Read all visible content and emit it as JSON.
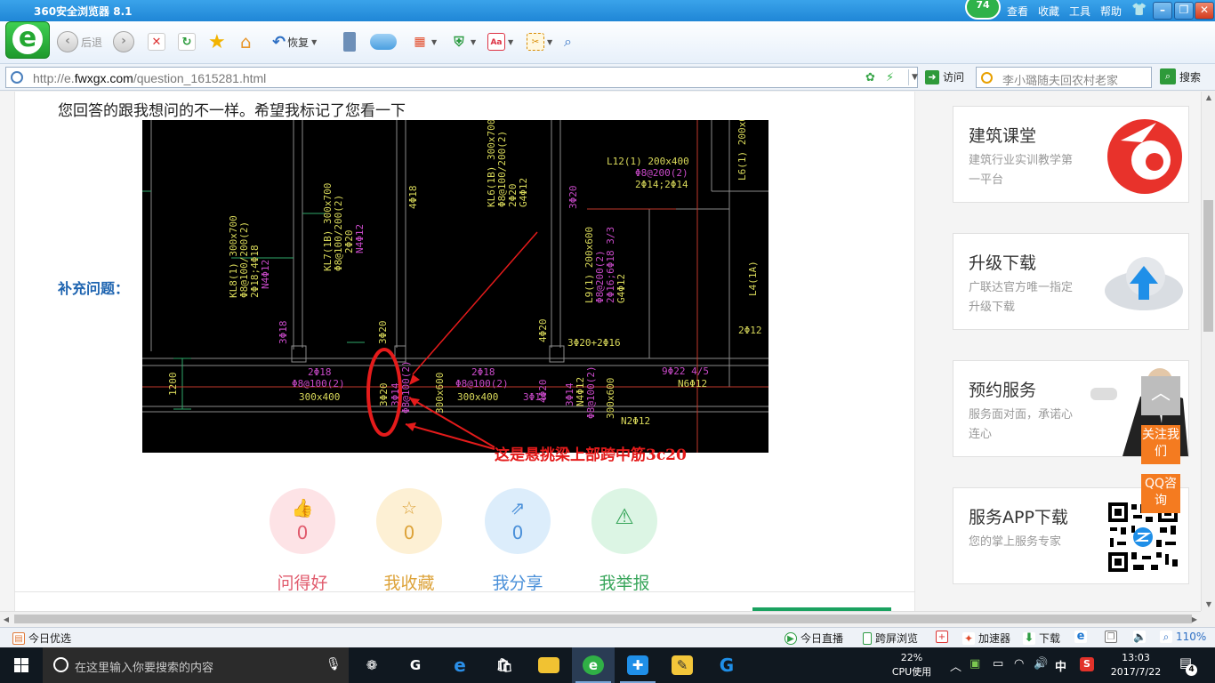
{
  "window": {
    "title": "360安全浏览器 8.1",
    "badge": "74",
    "menu": [
      "查看",
      "收藏",
      "工具",
      "帮助"
    ]
  },
  "toolbar": {
    "back_label": "后退",
    "restore_label": "恢复"
  },
  "address": {
    "url_prefix": "http://e.",
    "url_domain": "fwxgx.com",
    "url_suffix": "/question_1615281.html",
    "visit_label": "访问",
    "search_placeholder": "李小璐随夫回农村老家",
    "search_label": "搜索"
  },
  "page": {
    "reply_text": "您回答的跟我想问的不一样。希望我标记了您看一下",
    "supplement_label": "补充问题：",
    "annotation": "这是悬挑梁上部跨中筋3c20",
    "actions": [
      {
        "label": "问得好",
        "count": "0",
        "icon": "thumbs-up-icon",
        "glyph": "👍",
        "bg": "#fde3e6",
        "color": "#e05a6c"
      },
      {
        "label": "我收藏",
        "count": "0",
        "icon": "star-icon",
        "glyph": "☆",
        "bg": "#fdf0d4",
        "color": "#dda33a"
      },
      {
        "label": "我分享",
        "count": "0",
        "icon": "share-icon",
        "glyph": "⇗",
        "bg": "#dcedfb",
        "color": "#4a90d9"
      },
      {
        "label": "我举报",
        "count": "",
        "icon": "warning-icon",
        "glyph": "⚠",
        "bg": "#dcf5e4",
        "color": "#3aa65c"
      }
    ]
  },
  "sidebar": {
    "cards": [
      {
        "title": "建筑课堂",
        "subtitle": "建筑行业实训教学第一平台"
      },
      {
        "title": "升级下载",
        "subtitle": "广联达官方唯一指定升级下载"
      },
      {
        "title": "预约服务",
        "subtitle": "服务面对面，承诺心连心"
      },
      {
        "title": "服务APP下载",
        "subtitle": "您的掌上服务专家"
      }
    ],
    "float_follow": "关注我们",
    "float_qq": "QQ咨询"
  },
  "cad": {
    "labels": [
      "KL8(1) 300x700",
      "Φ8@100/200(2)",
      "2Φ18;4Φ18",
      "N4Φ12",
      "KL7(1B) 300x700",
      "Φ8@100/200(2)",
      "2Φ20",
      "N4Φ12",
      "KL6(1B) 300x700",
      "Φ8@100/200(2)",
      "2Φ20",
      "G4Φ12",
      "L12(1) 200x400",
      "Φ8@200(2)",
      "2Φ14;2Φ14",
      "L9(1) 200x600",
      "Φ8@200(2)",
      "2Φ16;6Φ18 3/3",
      "G4Φ12",
      "L6(1) 200x6",
      "L4(1A)",
      "3Φ18",
      "3Φ20",
      "4Φ18",
      "3Φ20",
      "4Φ20",
      "4Φ20",
      "3Φ20+2Φ16",
      "2Φ12",
      "2Φ18",
      "Φ8@100(2)",
      "300x400",
      "3Φ20",
      "3Φ14",
      "Φ8@100(2)",
      "300x600",
      "2Φ18",
      "Φ8@100(2)",
      "300x400",
      "3Φ18",
      "3Φ14",
      "N4Φ12",
      "Φ8@100(2)",
      "300x600",
      "9Φ22 4/5",
      "N6Φ12",
      "N2Φ12",
      "1200"
    ]
  },
  "statusbar": {
    "left": "今日优选",
    "items": [
      "今日直播",
      "跨屏浏览",
      "加速器",
      "下载"
    ],
    "zoom": "110%"
  },
  "taskbar": {
    "search_placeholder": "在这里输入你要搜索的内容",
    "cpu_percent": "22%",
    "cpu_label": "CPU使用",
    "ime": "中",
    "time": "13:03",
    "date": "2017/7/22",
    "notifications": "4"
  }
}
